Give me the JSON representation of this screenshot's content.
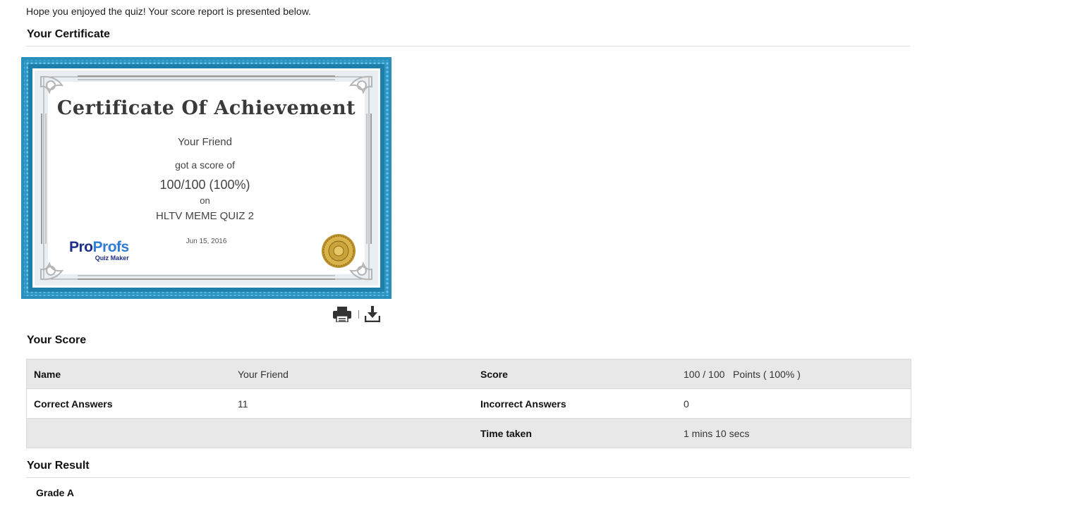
{
  "intro": "Hope you enjoyed the quiz! Your score report is presented below.",
  "sections": {
    "certificate": "Your Certificate",
    "score": "Your Score",
    "result": "Your Result"
  },
  "certificate": {
    "title": "Certificate Of Achievement",
    "recipient": "Your Friend",
    "got_score_text": "got a score of",
    "score": "100/100 (100%)",
    "on_text": "on",
    "quiz_name": "HLTV MEME QUIZ 2",
    "date": "Jun 15, 2016",
    "logo_pro": "Pro",
    "logo_profs": "Profs",
    "logo_sub": "Quiz Maker",
    "frame_color": "#2f97c4"
  },
  "actions": {
    "print_icon": "print-icon",
    "download_icon": "download-icon"
  },
  "score_table": {
    "rows": [
      {
        "l1": "Name",
        "v1": "Your Friend",
        "l2": "Score",
        "v2": "100 / 100   Points ( 100% )"
      },
      {
        "l1": "Correct Answers",
        "v1": "11",
        "l2": "Incorrect Answers",
        "v2": "0"
      },
      {
        "l1": "",
        "v1": "",
        "l2": "Time taken",
        "v2": "1 mins 10 secs"
      }
    ]
  },
  "result": {
    "grade": "Grade A"
  }
}
